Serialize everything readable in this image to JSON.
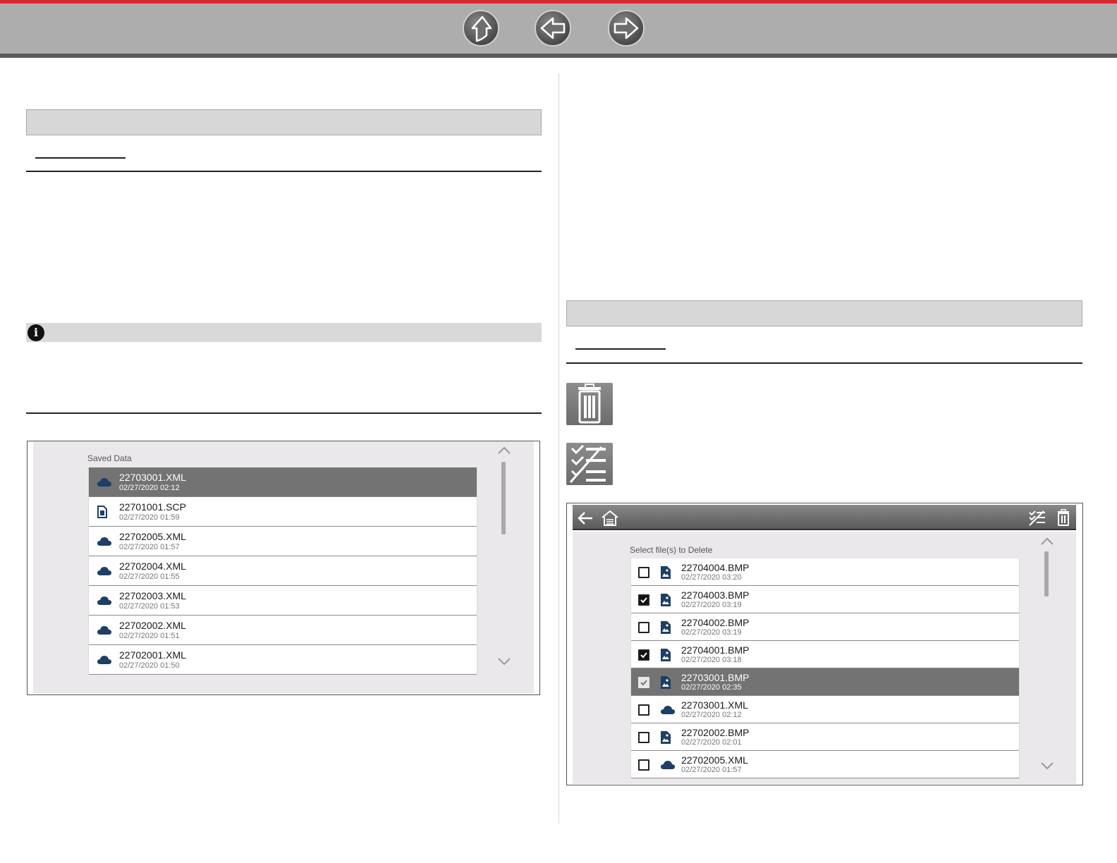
{
  "nav": {
    "up_icon": "up-arrow-icon",
    "back_icon": "back-arrow-icon",
    "forward_icon": "forward-arrow-icon"
  },
  "left_screenshot": {
    "list_title": "Saved Data",
    "files": [
      {
        "name": "22703001.XML",
        "date": "02/27/2020 02:12",
        "icon": "cloud-icon",
        "selected": true
      },
      {
        "name": "22701001.SCP",
        "date": "02/27/2020 01:59",
        "icon": "scope-file-icon",
        "selected": false
      },
      {
        "name": "22702005.XML",
        "date": "02/27/2020 01:57",
        "icon": "cloud-icon",
        "selected": false
      },
      {
        "name": "22702004.XML",
        "date": "02/27/2020 01:55",
        "icon": "cloud-icon",
        "selected": false
      },
      {
        "name": "22702003.XML",
        "date": "02/27/2020 01:53",
        "icon": "cloud-icon",
        "selected": false
      },
      {
        "name": "22702002.XML",
        "date": "02/27/2020 01:51",
        "icon": "cloud-icon",
        "selected": false
      },
      {
        "name": "22702001.XML",
        "date": "02/27/2020 01:50",
        "icon": "cloud-icon",
        "selected": false
      }
    ]
  },
  "right_screenshot": {
    "list_title": "Select file(s) to Delete",
    "files": [
      {
        "name": "22704004.BMP",
        "date": "02/27/2020 03:20",
        "icon": "image-file-icon",
        "checked": false,
        "selected": false
      },
      {
        "name": "22704003.BMP",
        "date": "02/27/2020 03:19",
        "icon": "image-file-icon",
        "checked": true,
        "selected": false
      },
      {
        "name": "22704002.BMP",
        "date": "02/27/2020 03:19",
        "icon": "image-file-icon",
        "checked": false,
        "selected": false
      },
      {
        "name": "22704001.BMP",
        "date": "02/27/2020 03:18",
        "icon": "image-file-icon",
        "checked": true,
        "selected": false
      },
      {
        "name": "22703001.BMP",
        "date": "02/27/2020 02:35",
        "icon": "image-file-icon",
        "checked": true,
        "selected": true
      },
      {
        "name": "22703001.XML",
        "date": "02/27/2020 02:12",
        "icon": "cloud-icon",
        "checked": false,
        "selected": false
      },
      {
        "name": "22702002.BMP",
        "date": "02/27/2020 02:01",
        "icon": "image-file-icon",
        "checked": false,
        "selected": false
      },
      {
        "name": "22702005.XML",
        "date": "02/27/2020 01:57",
        "icon": "cloud-icon",
        "checked": false,
        "selected": false
      }
    ]
  },
  "icons": {
    "delete_icon": "trash-icon",
    "select_all_icon": "select-all-icon"
  },
  "colors": {
    "accent_red": "#e0242f",
    "file_icon_blue": "#1e3f63",
    "selected_row": "#737373"
  }
}
